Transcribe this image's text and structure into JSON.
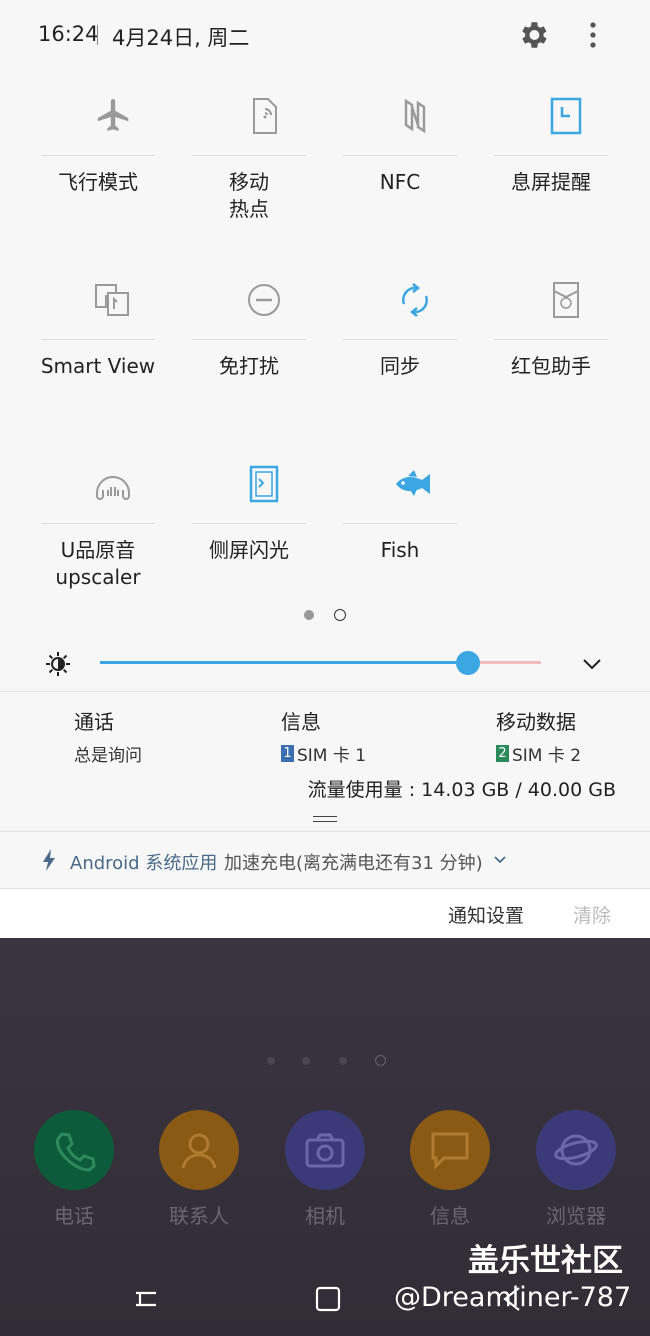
{
  "status": {
    "time": "16:24",
    "date": "4月24日, 周二"
  },
  "tiles": [
    {
      "label": "飞行模式",
      "icon": "airplane-icon",
      "active": false
    },
    {
      "label": "移动\n热点",
      "icon": "hotspot-icon",
      "active": false
    },
    {
      "label": "NFC",
      "icon": "nfc-icon",
      "active": false
    },
    {
      "label": "息屏提醒",
      "icon": "always-on-display-icon",
      "active": true
    },
    {
      "label": "Smart View",
      "icon": "smart-view-icon",
      "active": false
    },
    {
      "label": "免打扰",
      "icon": "do-not-disturb-icon",
      "active": false
    },
    {
      "label": "同步",
      "icon": "sync-icon",
      "active": true
    },
    {
      "label": "红包助手",
      "icon": "red-envelope-icon",
      "active": false
    },
    {
      "label": "U品原音\nupscaler",
      "icon": "headphones-icon",
      "active": false
    },
    {
      "label": "侧屏闪光",
      "icon": "edge-lighting-icon",
      "active": true
    },
    {
      "label": "Fish",
      "icon": "fish-icon",
      "active": true
    }
  ],
  "brightness": {
    "level_percent": 82
  },
  "sim": {
    "call_title": "通话",
    "call_value": "总是询问",
    "msg_title": "信息",
    "msg_badge": "1",
    "msg_value": "SIM 卡 1",
    "data_title": "移动数据",
    "data_badge": "2",
    "data_value": "SIM 卡 2",
    "usage": "流量使用量 : 14.03 GB / 40.00 GB"
  },
  "notification": {
    "app": "Android 系统应用",
    "text": "加速充电(离充满电还有31 分钟)"
  },
  "footer": {
    "settings": "通知设置",
    "clear": "清除"
  },
  "apps": [
    {
      "label": "电话",
      "icon": "phone-icon",
      "color": "#0c5c3c"
    },
    {
      "label": "联系人",
      "icon": "contacts-icon",
      "color": "#8a5a14"
    },
    {
      "label": "相机",
      "icon": "camera-icon",
      "color": "#3b3a78"
    },
    {
      "label": "信息",
      "icon": "message-icon",
      "color": "#8a5a14"
    },
    {
      "label": "浏览器",
      "icon": "browser-icon",
      "color": "#3b3a78"
    }
  ],
  "watermark": {
    "line1": "盖乐世社区",
    "line2": "@Dreamliner-787"
  },
  "colors": {
    "accent": "#3aa6e2",
    "inactive_icon": "#9a9a9a"
  }
}
